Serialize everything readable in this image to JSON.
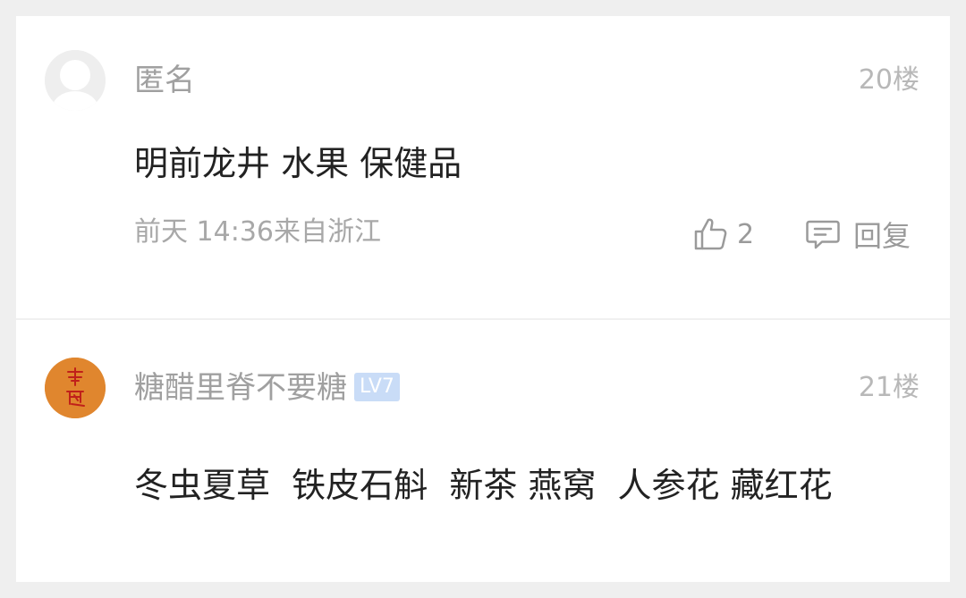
{
  "comments": [
    {
      "username": "匿名",
      "floor": "20楼",
      "text": "明前龙井 水果 保健品",
      "meta": "前天 14:36来自浙江",
      "likes": "2",
      "reply_label": "回复",
      "avatar_icon": "default-user-avatar"
    },
    {
      "username": "糖醋里脊不要糖",
      "level": "LV7",
      "floor": "21楼",
      "text": "冬虫夏草  铁皮石斛  新茶 燕窝  人参花 藏红花",
      "avatar_icon": "seal-stamp-avatar"
    }
  ],
  "colors": {
    "background": "#efefef",
    "card": "#ffffff",
    "username": "#a0a0a0",
    "level_badge": "#c9dcf7",
    "content": "#222222",
    "avatar2": "#e0862e",
    "seal_text": "#c0201a"
  }
}
